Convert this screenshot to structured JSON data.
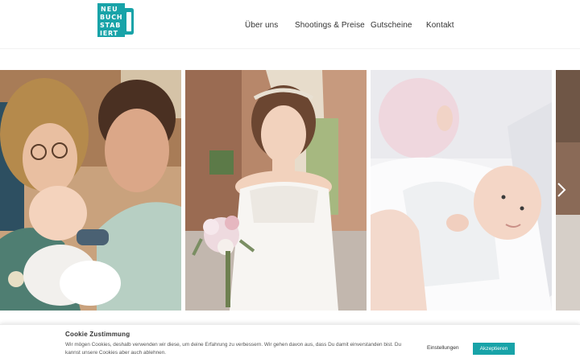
{
  "header": {
    "logo_text": "NEU BUCH STA B IERT",
    "logo_lines": [
      "NEU",
      "BUCH",
      "STAB",
      "IERT"
    ],
    "logo_color": "#18a3a8"
  },
  "nav": {
    "items": [
      {
        "label": "Über uns"
      },
      {
        "label": "Shootings & Preise"
      },
      {
        "label": "Gutscheine"
      },
      {
        "label": "Kontakt"
      }
    ]
  },
  "gallery": {
    "photos": [
      {
        "subject": "family-with-baby"
      },
      {
        "subject": "bride-with-bouquet"
      },
      {
        "subject": "newborn-baby"
      },
      {
        "subject": "partial-photo"
      }
    ],
    "next_icon": "chevron-right-icon"
  },
  "cookie": {
    "title": "Cookie Zustimmung",
    "text": "Wir mögen Cookies, deshalb verwenden wir diese, um deine Erfahrung zu verbessern. Wir gehen davon aus, dass Du damit einverstanden bist. Du kannst unsere Cookies aber auch ablehnen.",
    "settings_label": "Einstellungen",
    "accept_label": "Akzeptieren",
    "accent_color": "#18a3a8"
  }
}
